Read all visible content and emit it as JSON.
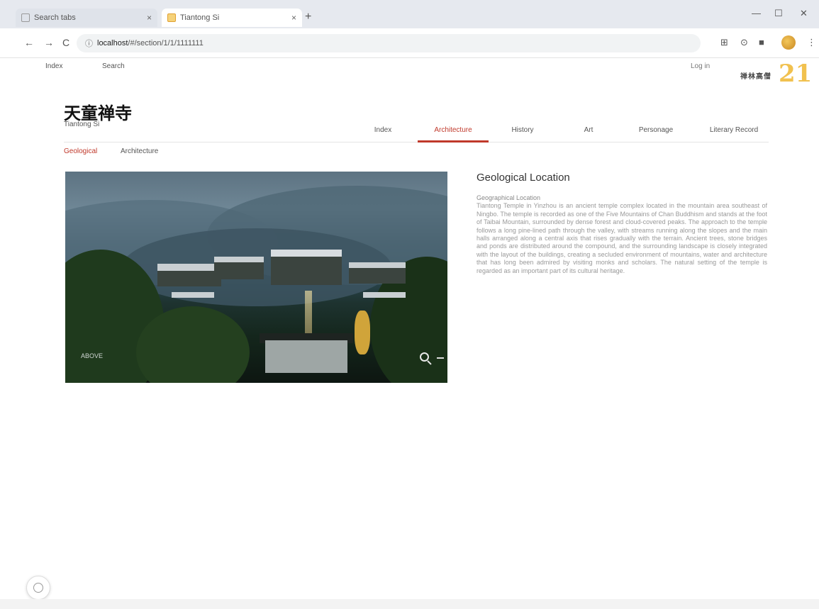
{
  "browser": {
    "tabs": [
      {
        "label": "Search tabs"
      },
      {
        "label": "Tiantong Si"
      }
    ],
    "new_tab": "+",
    "close": "×",
    "url_host": "localhost",
    "url_rest": "/#/section/1/1/1111111",
    "nav_back": "←",
    "nav_forward": "→",
    "nav_reload": "C",
    "win_min": "—",
    "win_max": "☐",
    "win_close": "✕"
  },
  "site": {
    "links": [
      "Index",
      "Search"
    ],
    "login": "Log in",
    "logo_text": "禅林高僧",
    "logo_num": "21"
  },
  "page": {
    "title_cn": "天童禅寺",
    "title_en": "Tiantong Si",
    "tabs": [
      "Index",
      "Architecture",
      "History",
      "Art",
      "Personage",
      "Literary Record"
    ],
    "active_tab": 1,
    "subtabs": [
      "Geological",
      "Architecture"
    ],
    "active_subtab": 0
  },
  "photo": {
    "caption": "ABOVE"
  },
  "section": {
    "title": "Geological Location",
    "lead": "Geographical Location",
    "body": "Tiantong Temple in Yinzhou is an ancient temple complex located in the mountain area southeast of Ningbo. The temple is recorded as one of the Five Mountains of Chan Buddhism and stands at the foot of Taibai Mountain, surrounded by dense forest and cloud-covered peaks. The approach to the temple follows a long pine-lined path through the valley, with streams running along the slopes and the main halls arranged along a central axis that rises gradually with the terrain. Ancient trees, stone bridges and ponds are distributed around the compound, and the surrounding landscape is closely integrated with the layout of the buildings, creating a secluded environment of mountains, water and architecture that has long been admired by visiting monks and scholars. The natural setting of the temple is regarded as an important part of its cultural heritage."
  }
}
